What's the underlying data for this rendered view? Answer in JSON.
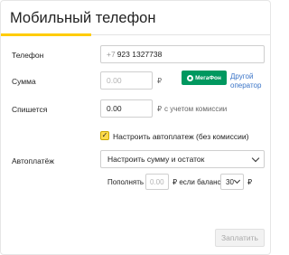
{
  "header": {
    "title": "Мобильный телефон"
  },
  "colors": {
    "accent": "#ffcc00",
    "operator_brand": "#00985f",
    "link": "#3a74c7"
  },
  "phone": {
    "label": "Телефон",
    "prefix": "+7",
    "value": "923 1327738"
  },
  "amount": {
    "label": "Сумма",
    "placeholder": "0.00",
    "currency": "₽"
  },
  "operator": {
    "name": "МегаФон",
    "icon": "megafon-logo",
    "other_link_line1": "Другой",
    "other_link_line2": "оператор"
  },
  "charge": {
    "label": "Спишется",
    "value": "0.00",
    "currency": "₽",
    "note": "с учетом комиссии"
  },
  "autopay": {
    "checkbox_label": "Настроить автоплатеж (без комиссии)",
    "checked": true,
    "label": "Автоплатёж",
    "select_value": "Настроить сумму и остаток",
    "topup_text": "Пополнять на",
    "topup_placeholder": "0.00",
    "if_balance_text": "₽ если баланс",
    "balance_value": "30",
    "currency": "₽"
  },
  "submit": {
    "label": "Заплатить"
  }
}
